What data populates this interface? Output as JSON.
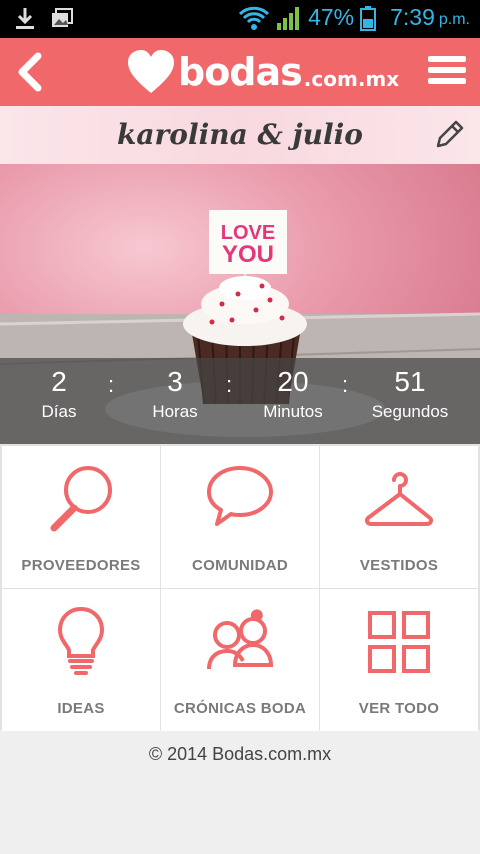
{
  "status_bar": {
    "battery": "47%",
    "time": "7:39",
    "ampm": "p.m.",
    "icons": [
      "download-icon",
      "image-icon",
      "wifi-icon",
      "signal-icon",
      "battery-icon"
    ]
  },
  "header": {
    "logo_name": "bodas",
    "logo_tld": ".com.mx",
    "accent_color": "#f0686a"
  },
  "couple": {
    "names": "karolina & julio"
  },
  "countdown": {
    "days": "2",
    "days_label": "Días",
    "hours": "3",
    "hours_label": "Horas",
    "minutes": "20",
    "minutes_label": "Minutos",
    "seconds": "51",
    "seconds_label": "Segundos",
    "separator": ":"
  },
  "hero_card": {
    "line1": "LOVE",
    "line2": "YOU"
  },
  "menu": [
    {
      "label": "PROVEEDORES",
      "icon": "magnifier-icon"
    },
    {
      "label": "COMUNIDAD",
      "icon": "speech-bubble-icon"
    },
    {
      "label": "VESTIDOS",
      "icon": "hanger-icon"
    },
    {
      "label": "IDEAS",
      "icon": "lightbulb-icon"
    },
    {
      "label": "CRÓNICAS BODA",
      "icon": "couple-icon"
    },
    {
      "label": "VER TODO",
      "icon": "grid-icon"
    }
  ],
  "footer": {
    "copyright": "© 2014 Bodas.com.mx"
  }
}
